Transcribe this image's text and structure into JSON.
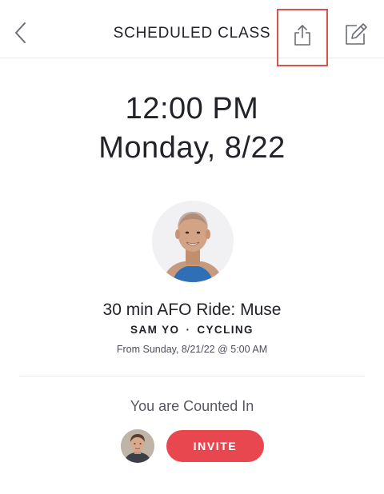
{
  "header": {
    "title": "SCHEDULED CLASS",
    "back_icon": "chevron-left-icon",
    "share_icon": "share-icon",
    "edit_icon": "edit-icon",
    "highlight_color": "#d9534f"
  },
  "schedule": {
    "time": "12:00 PM",
    "date": "Monday, 8/22"
  },
  "class": {
    "title": "30 min AFO Ride: Muse",
    "instructor": "SAM YO",
    "separator": "·",
    "discipline": "CYCLING",
    "from": "From Sunday, 8/21/22 @ 5:00 AM"
  },
  "attendance": {
    "counted_text": "You are Counted In",
    "invite_label": "INVITE",
    "invite_color": "#e9474f"
  }
}
